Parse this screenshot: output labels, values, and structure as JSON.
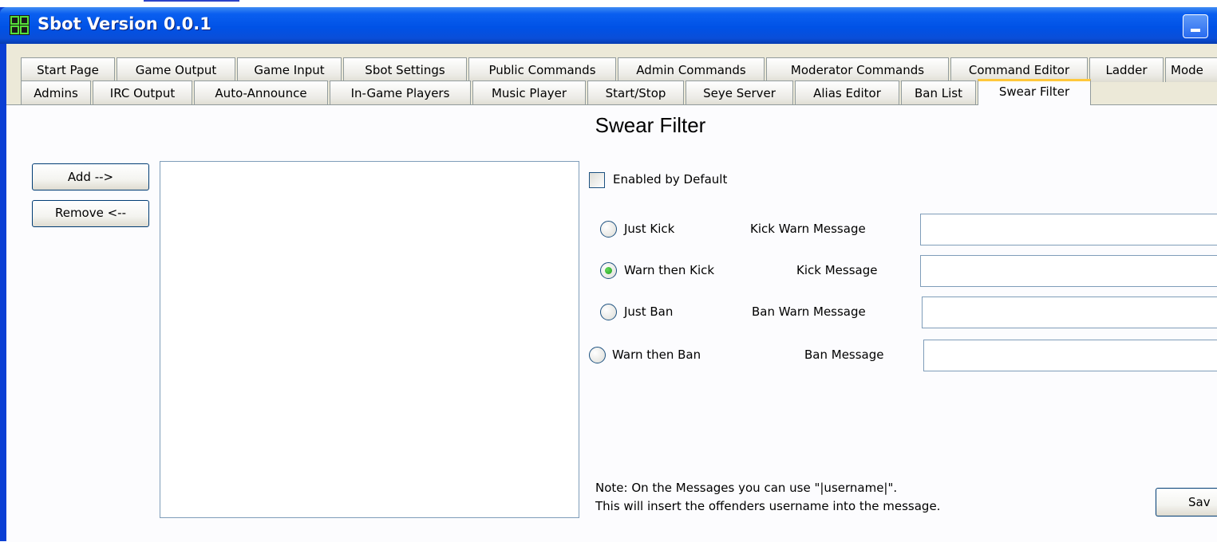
{
  "window": {
    "title": "Sbot Version 0.0.1"
  },
  "tabs_row1": [
    "Start Page",
    "Game Output",
    "Game Input",
    "Sbot Settings",
    "Public Commands",
    "Admin Commands",
    "Moderator Commands",
    "Command Editor",
    "Ladder",
    "Mode"
  ],
  "tabs_row2": [
    "Admins",
    "IRC Output",
    "Auto-Announce",
    "In-Game Players",
    "Music Player",
    "Start/Stop",
    "Seye Server",
    "Alias Editor",
    "Ban List",
    "Swear Filter"
  ],
  "active_tab": "Swear Filter",
  "page": {
    "title": "Swear Filter",
    "add_button": "Add -->",
    "remove_button": "Remove <--",
    "enabled_by_default": {
      "label": "Enabled by Default",
      "checked": false
    },
    "options": [
      {
        "label": "Just Kick",
        "selected": false,
        "field_label": "Kick Warn Message",
        "field_value": ""
      },
      {
        "label": "Warn then Kick",
        "selected": true,
        "field_label": "Kick Message",
        "field_value": ""
      },
      {
        "label": "Just Ban",
        "selected": false,
        "field_label": "Ban Warn Message",
        "field_value": ""
      },
      {
        "label": "Warn then Ban",
        "selected": false,
        "field_label": "Ban Message",
        "field_value": ""
      }
    ],
    "note_line1": "Note: On the Messages you can use \"|username|\".",
    "note_line2": "This will insert the offenders username into the message.",
    "save_button": "Sav"
  },
  "colors": {
    "titlebar": "#0052e6",
    "dialog": "#ece9d8",
    "active_tab_highlight": "#ffc83c",
    "radio_dot": "#21a121"
  }
}
